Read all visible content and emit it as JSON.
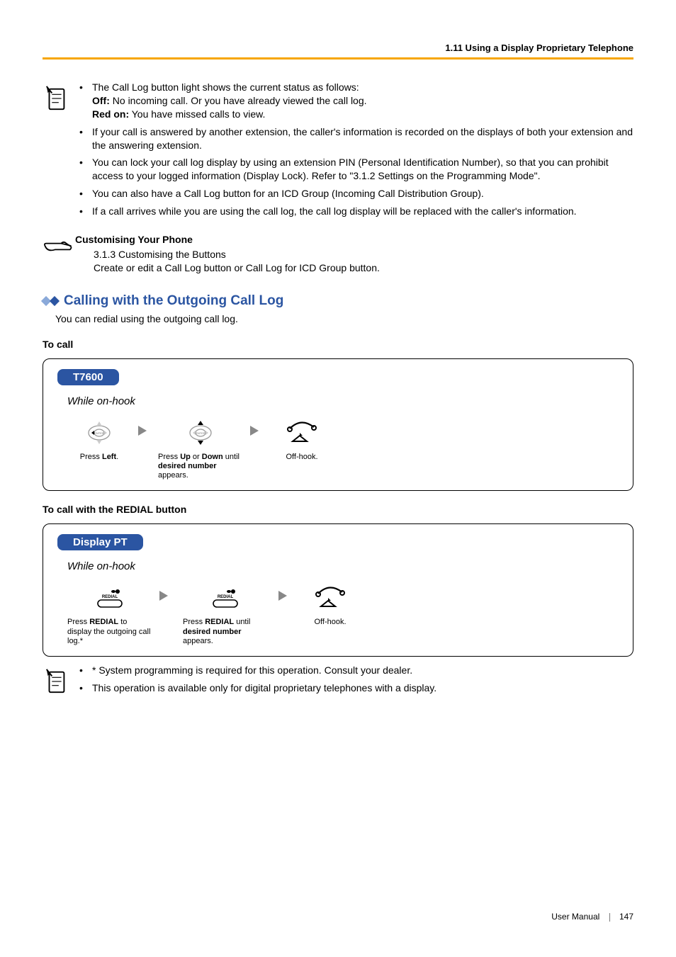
{
  "header": {
    "breadcrumb": "1.11 Using a Display Proprietary Telephone"
  },
  "notes1": {
    "items": [
      {
        "pre": "The Call Log button light shows the current status as follows:",
        "sub": [
          {
            "bold": "Off:",
            "text": " No incoming call. Or you have already viewed the call log."
          },
          {
            "bold": "Red on:",
            "text": " You have missed calls to view."
          }
        ]
      },
      {
        "text": "If your call is answered by another extension, the caller's information is recorded on the displays of both your extension and the answering extension."
      },
      {
        "text": "You can lock your call log display by using an extension PIN (Personal Identification Number), so that you can prohibit access to your logged information (Display Lock). Refer to \"3.1.2 Settings on the Programming Mode\"."
      },
      {
        "text": "You can also have a Call Log button for an ICD Group (Incoming Call Distribution Group)."
      },
      {
        "text": "If a call arrives while you are using the call log, the call log display will be replaced with the caller's information."
      }
    ]
  },
  "customise": {
    "heading": "Customising Your Phone",
    "line1": "3.1.3 Customising the Buttons",
    "line2": "Create or edit a Call Log button or Call Log for ICD Group button."
  },
  "section": {
    "title": "Calling with the Outgoing Call Log",
    "intro": "You can redial using the outgoing call log."
  },
  "proc1": {
    "heading": "To call",
    "model": "T7600",
    "context": "While on-hook",
    "step1_pre": "Press ",
    "step1_bold": "Left",
    "step1_post": ".",
    "step2_pre": "Press ",
    "step2_b1": "Up",
    "step2_mid": " or ",
    "step2_b2": "Down",
    "step2_line2a": " until ",
    "step2_line2b": "desired number",
    "step2_line3": " appears.",
    "step3": "Off-hook."
  },
  "proc2": {
    "heading": "To call with the REDIAL button",
    "model": "Display PT",
    "context": "While on-hook",
    "step1_pre": "Press ",
    "step1_bold": "REDIAL",
    "step1_post": " to display the outgoing call log.*",
    "step2_pre": "Press ",
    "step2_bold": "REDIAL",
    "step2_line2a": " until ",
    "step2_line2b": "desired number",
    "step2_line3": " appears.",
    "step3": "Off-hook."
  },
  "notes2": {
    "items": [
      "* System programming is required for this operation. Consult your dealer.",
      "This operation is available only for digital proprietary telephones with a display."
    ]
  },
  "footer": {
    "label": "User Manual",
    "page": "147"
  },
  "keylabel": {
    "enter": "ENTER",
    "redial": "REDIAL"
  }
}
